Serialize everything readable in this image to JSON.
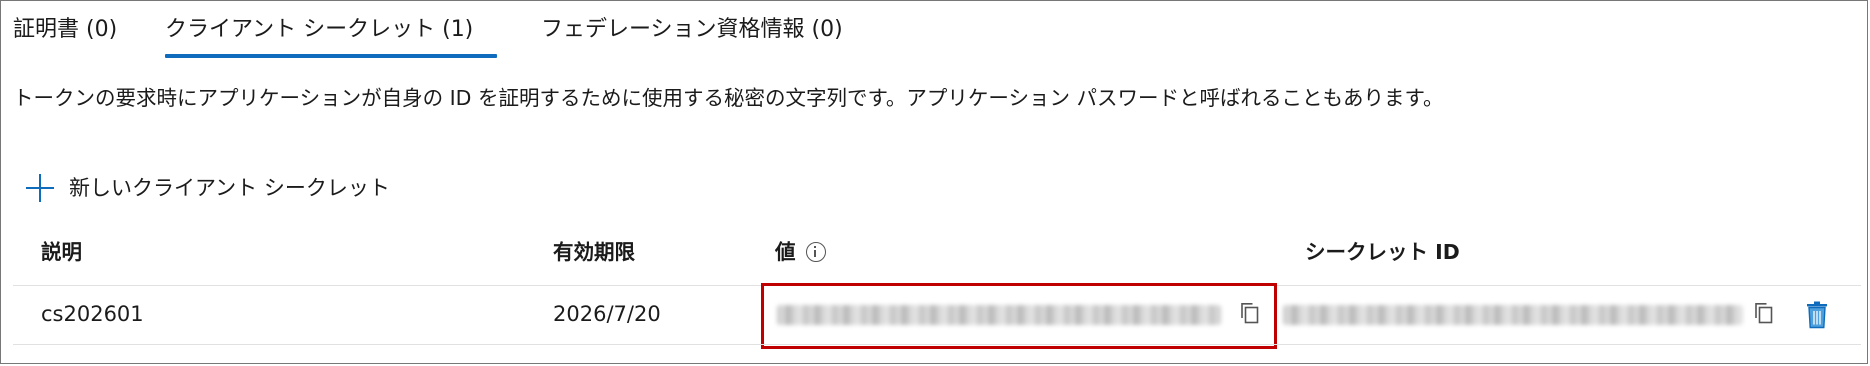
{
  "tabs": [
    {
      "label": "証明書 (0)",
      "active": false
    },
    {
      "label": "クライアント シークレット (1)",
      "active": true
    },
    {
      "label": "フェデレーション資格情報 (0)",
      "active": false
    }
  ],
  "description": "トークンの要求時にアプリケーションが自身の ID を証明するために使用する秘密の文字列です。アプリケーション パスワードと呼ばれることもあります。",
  "new_secret_label": "新しいクライアント シークレット",
  "table": {
    "headers": {
      "description": "説明",
      "expires": "有効期限",
      "value": "値",
      "secret_id": "シークレット ID"
    },
    "rows": [
      {
        "description": "cs202601",
        "expires": "2026/7/20",
        "value": "",
        "secret_id": ""
      }
    ]
  },
  "icons": {
    "add": "plus-icon",
    "info": "info-icon",
    "copy": "copy-icon",
    "delete": "trash-icon"
  },
  "colors": {
    "accent": "#0f6cbd",
    "highlight": "#c00000"
  }
}
